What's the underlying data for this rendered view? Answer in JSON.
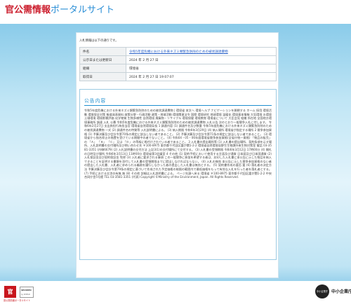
{
  "header": {
    "title_main": "官公需情報",
    "title_sub": "ポータルサイト"
  },
  "page": {
    "lead_text": "入札情報は以下の通りです。"
  },
  "meta_table": {
    "rows": [
      {
        "key": "件名",
        "value": "令和5年度危機における外来ネズミ類緊急防除のための被状調達費物"
      },
      {
        "key": "公示日または更新日",
        "value": "2024 年 2 月 27 日"
      },
      {
        "key": "組織",
        "value": "環境省"
      },
      {
        "key": "取得日",
        "value": "2024 年 2 月 27 日 19:07:07"
      }
    ]
  },
  "notice": {
    "title": "公告内容",
    "body": "令和5年度危機における外来ネズミ類緊急防除のための被状調達費物 | 環境省 本文へ 環境へルプ ナビゲーションを開閉する ホーム 採用 環境活動 環境保全対策 報道発表資料 政策分野・行政活動 政策・地域活動 環境関連法令 国際 環境研究 地球環境 温暖化 環境基本情報 大気環境 水環境 土壌環境 環境影響評価 化学物質 生物多様性 自然環境 廃棄物・リサイクル 環境保健 環境教育 環境省について 大臣会見 組織 所在地 全国地方環境事務所 調達 入札 公募 令和5年度危機における外来ネズミ類緊急防除のための被状調達費物 入札公告 次のとおり一般競争入札に付します。 令和6年2月27日 支出負担行為担当官 環境省自然環境局長 1 調達内容 (1) 調達件名及び数量 令和5年度危機における外来ネズミ類緊急防除のための被状調達費物 一式 (2) 調達件名の特質等 入札説明書による。 (3) 納入期限 令和6年3月29日 (4) 納入場所 環境省が指定する場所 2 競争参加資格 (1) 予算決算及び会計令第70条の規定に該当しない者であること。 (2) 予算決算及び会計令第71条の規定に該当しない者であること。 (3) 環境省から指名停止の措置を受けている期間中の者でないこと。 (4) 令和04・05・06年度環境省競争参加資格(全省庁統一資格) 「物品の販売」 の 「Ａ」 「Ｂ」 「Ｃ」 又は 「Ｄ」 の等級に格付けされている者であること。 3 入札書の提出場所等 (1) 入札書の提出場所、契約条項を示す場所、入札説明書の交付場所及び問い合わせ先 〒100-8975 東京都千代田区霞が関1-2-2 環境省自然環境局野生生物課外来生物対策室 電話 03-3581-3351 (内線6679) (2) 入札説明書の交付方法 上記3(1)の交付場所にて交付する。 (3) 入札書の受領期限 令和6年3月12日 17時00分 (4) 開札の日時及び場所 令和6年3月13日 11時00分 環境省第3会議室 4 その他 (1) 契約手続において使用する言語及び通貨 日本語及び日本国通貨 (2) 入札保証金及び契約保証金 免除 (3) 入札者に要求される事項 この一般競争に参加を希望する者は、封印した入札書に本公告に示した物品を納入できることを証明する書類を添付して入札書の受領期限までに提出しなければならない。 (4) 入札の無効 本公告に示した競争参加資格のない者の提出した入札書、入札者に求められる義務を履行しなかった者の提出した入札書は無効とする。 (5) 契約書作成の要否 要 (6) 落札者の決定方法 予算決算及び会計令第79条の規定に基づいて作成された予定価格の制限の範囲内で最低価格をもって有効な入札を行った者を落札者とする。 (7) 手続における交渉の有無 無 (8) その他 詳細は入札説明書による。 ページ先頭へ戻る 環境省 〒100-8975 東京都千代田区霞が関1-2-2 中央合同庁舎5号館 TEL 03-3581-3351 (代表) Copyright ©Ministry of the Environment, Japan. All Rights Reserved."
  },
  "footer": {
    "kanpo_logo_text": "官",
    "kanpo_label": "官公需情報ポータルサイト",
    "secured_line1": "SECURED",
    "secured_line2": "by SHIELD",
    "agency_emblem_text": "中小企業庁",
    "agency_name": "中小企業庁"
  },
  "colors": {
    "title_red": "#cc1f2e",
    "title_blue": "#2b8fd6",
    "link_blue": "#2a62c9",
    "notice_accent": "#1f8fcf",
    "background_sky": "#79c3e6"
  },
  "icons": {
    "kanpo_logo": "kanpo-logo-icon",
    "secured_badge": "secured-badge-icon",
    "agency_emblem": "agency-emblem-icon"
  }
}
